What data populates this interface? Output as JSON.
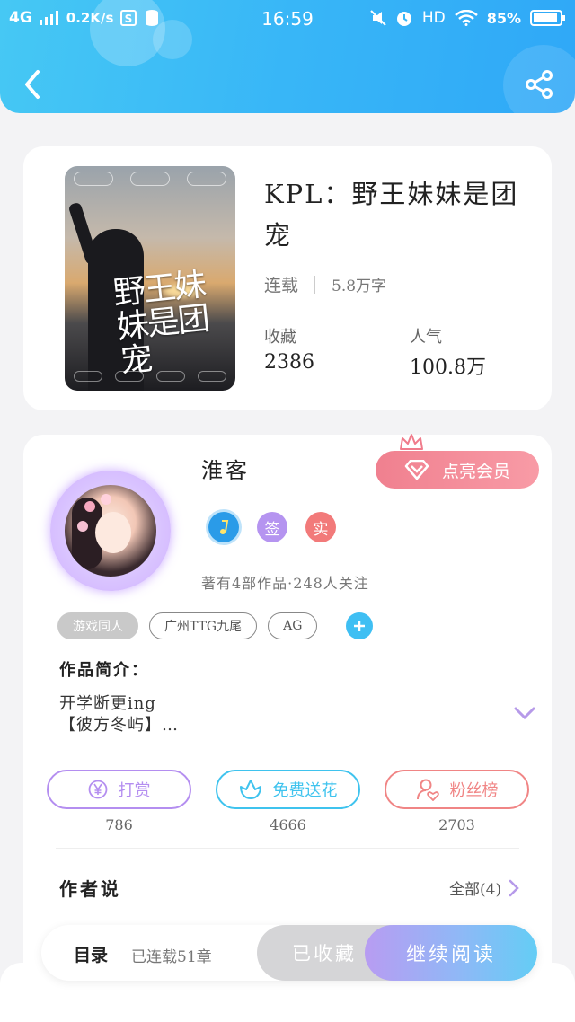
{
  "status_bar": {
    "network": "4G",
    "speed": "0.2K/s",
    "time": "16:59",
    "hd": "HD",
    "battery": "85%"
  },
  "header": {
    "back_icon": "chevron-left-icon",
    "share_icon": "share-icon",
    "colors": {
      "gradient_start": "#46c8f4",
      "gradient_end": "#2fa8f7"
    }
  },
  "book": {
    "title": "KPL：野王妹妹是团宠",
    "cover_title": "野王妹妹是团宠",
    "status": "连载",
    "word_count": "5.8万字",
    "favorites_label": "收藏",
    "favorites_value": "2386",
    "popularity_label": "人气",
    "popularity_value": "100.8万"
  },
  "author": {
    "name": "淮客",
    "vip_label": "点亮会员",
    "badges": [
      {
        "text": "",
        "icon": "music-note-icon",
        "color": "#2a9be8"
      },
      {
        "text": "签",
        "color": "#b594f0"
      },
      {
        "text": "实",
        "color": "#f27a7a"
      }
    ],
    "stats": "著有4部作品·248人关注",
    "tags": [
      "游戏同人",
      "广州TTG九尾",
      "AG"
    ],
    "intro_title": "作品简介：",
    "intro_line1": "开学断更ing",
    "intro_line2": "【彼方冬屿】…"
  },
  "actions": [
    {
      "label": "打赏",
      "count": "786",
      "color": "#b48ef0",
      "icon": "yuan-icon"
    },
    {
      "label": "免费送花",
      "count": "4666",
      "color": "#3fc3ee",
      "icon": "flower-icon"
    },
    {
      "label": "粉丝榜",
      "count": "2703",
      "color": "#f08585",
      "icon": "user-heart-icon"
    }
  ],
  "author_says": {
    "title": "作者说",
    "all_label": "全部(4)"
  },
  "bottom_bar": {
    "toc_label": "目录",
    "chapters": "已连载51章",
    "collected_label": "已收藏",
    "continue_label": "继续阅读"
  }
}
